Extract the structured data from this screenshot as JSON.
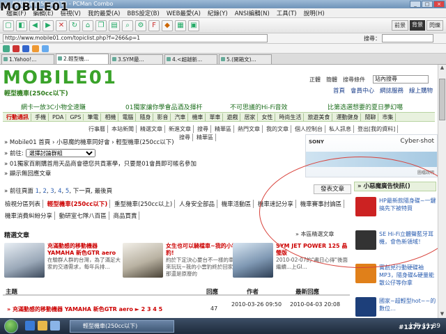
{
  "window": {
    "title": "輕型機車(250cc以下) - PCMan Combo",
    "min": "_",
    "max": "□",
    "close": "×"
  },
  "menu": [
    "檔案(F)",
    "編輯(E)",
    "檢視(V)",
    "我的最愛(A)",
    "BBS設定(B)",
    "WEB最愛(A)",
    "紀錄(Y)",
    "ANSI編輯(N)",
    "工具(T)",
    "說明(H)"
  ],
  "toolbar": {
    "pills": [
      "前景",
      "背景",
      "閃爍"
    ]
  },
  "address": {
    "url": "http://www.mobile01.com/topiclist.php?f=266&p=1",
    "search_label": "搜尋："
  },
  "tabs": [
    "1.Yahoo!...",
    "2.輕型機...",
    "3.SYM最...",
    "4.<超越新...",
    "5.(開箱文)..."
  ],
  "site": {
    "logo": "MOBILE01",
    "forum_title": "輕型機車(250cc以下)",
    "toplinks": [
      "正體",
      "簡體",
      "搜尋條件"
    ],
    "site_search_value": "站內搜尋",
    "nav": [
      "首頁",
      "會員中心",
      "網誌服務",
      "線上購物"
    ],
    "promos": [
      "網卡一放3C小物全速賺",
      "01獨家讓你學會品酒及揮杆",
      "不可思議的Hi-Fi音效",
      "比第选選想要的夏日夢幻噶"
    ],
    "categories": [
      "行動通訊",
      "手機",
      "PDA",
      "GPS",
      "筆電",
      "相機",
      "電腦",
      "隨身",
      "影音",
      "汽車",
      "機車",
      "單車",
      "遊戲",
      "居家",
      "女性",
      "時尚生活",
      "旅遊美食",
      "運動健身",
      "閒聊",
      "市集"
    ],
    "subnav": [
      "行事曆",
      "本站新聞",
      "精選文章",
      "新進文章",
      "搜尋",
      "精華區",
      "熱門文章",
      "我的文章",
      "個人控制台",
      "私人訊息",
      "登出[我的資料]"
    ],
    "subnav2": [
      "搜尋",
      "精華區"
    ],
    "breadcrumb": "» Mobile01 首頁 › 小惡魔的機車同好會 › 輕型機車(250cc以下)",
    "goto_label": "» 前往:",
    "goto_value": "選擇討論群組",
    "notice": "» 01獨家百刷購首用天品商會德您共貢憲學，只要是01會員即可帳名參加",
    "show_hidden": "» 顯示無回應文章",
    "pager_prefix": "» 前往頁面",
    "pager_pages": [
      "1",
      "2",
      "3",
      "4",
      "5"
    ],
    "pager_suffix": ", 下一頁, 最後頁",
    "post_button": "發表文章",
    "board_tabs": [
      "檢視分區列表",
      "輕型機車(250cc以下)",
      "重型機車(250cc以上)",
      "人身安全部品",
      "機車活動區",
      "機車速記分享",
      "機車賽事討論區",
      "機車消費糾紛分享",
      "動研室七隊八百區",
      "商品買賣"
    ],
    "featured_title": "精選文章",
    "featured_more": "» 本區精選文章",
    "cards": [
      {
        "title": "充滿動感的移動機器 YAMAHA 新色GTR aero",
        "desc": "在驗群人群的台灣，為了滿足大家的交通需求，每年兵排..."
      },
      {
        "title": "女生也可以騎檔車~我的小雲豹!",
        "desc": "約於下定決心要台不一樣的車子來玩玩~我的小雲豹終於回家了!那還是原廢的"
      },
      {
        "title": "SYM JET POWER 125 晶瑩版",
        "desc": "2010-02-07的\"盡日心得\"後面繼續...上GI..."
      }
    ],
    "table_headers": [
      "主題",
      "回應",
      "作者",
      "最新回應"
    ],
    "rows": [
      {
        "title": "» 充滿動感的移動機器 YAMAHA 新色GTR aero ► 2 3 4 5",
        "replies": "47",
        "author": "2010-03-26 09:50",
        "last": "2010-04-03 20:08"
      }
    ],
    "side_header": "» 小惡魔廣告快訊()",
    "side_items": [
      "HP最新款隨身碟~一鍵搞先下被特買",
      "SE Hi-Fi立體聲藍牙耳機，會色新領域！",
      "實創見行動硬碟袖MP3，隨身碟&硬量能散公仔等你拿",
      "國家~超輕型hot~~的數位…"
    ],
    "ad": {
      "brand": "SONY",
      "product": "Cyber-shot",
      "caption": "圖檔說明"
    }
  },
  "taskbar": {
    "item": "輕型機車(250cc以下)",
    "clock": "上午 11:39"
  },
  "watermark": "MOBILE01",
  "badge": "#1377377"
}
